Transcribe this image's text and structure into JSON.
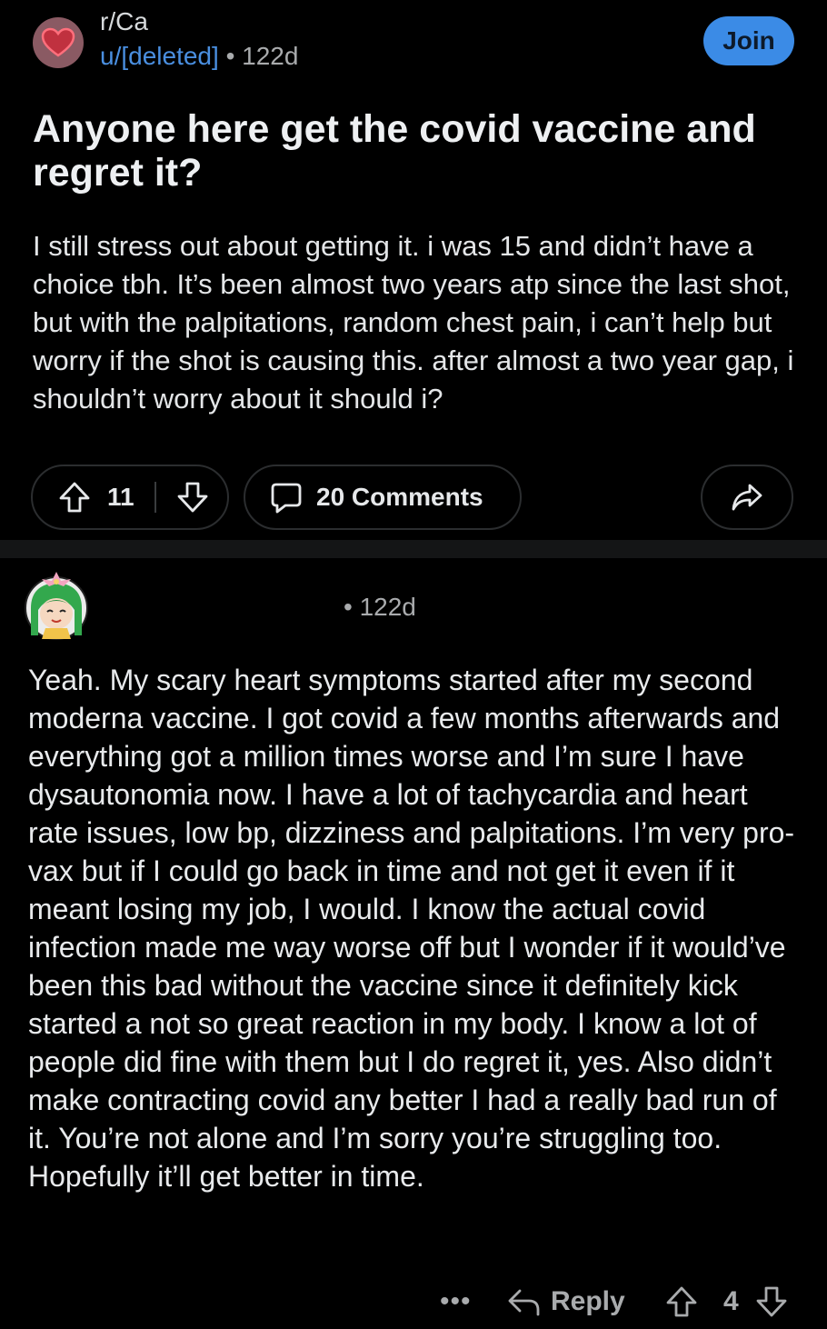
{
  "post": {
    "subreddit": "r/Ca",
    "author": "u/[deleted]",
    "separator": "•",
    "age": "122d",
    "join_label": "Join",
    "title": "Anyone here get the covid vaccine and regret it?",
    "body": "I still stress out about getting it. i was 15 and didn’t have a choice tbh. It’s been almost two years atp since the last shot, but with the palpitations, random chest pain, i can’t help but worry if the shot is causing this. after almost a two year gap, i shouldn’t worry about it should i?",
    "score": "11",
    "comments_label": "20 Comments"
  },
  "comment": {
    "separator": "•",
    "age": "122d",
    "body": "Yeah. My scary heart symptoms started after my second moderna vaccine. I got covid a few months afterwards and everything got a million times worse and I’m sure I have dysautonomia now. I have a lot of tachycardia and heart rate issues, low bp, dizziness and palpitations. I’m very pro-vax but if I could go back in time and not get it even if it meant losing my job, I would. I know the actual covid infection made me way worse off but I wonder if it would’ve been this bad without the vaccine since it definitely kick started a not so great reaction in my body. I know a lot of people did fine with them but I do regret it, yes. Also didn’t make contracting covid any better I had a really bad run of it. You’re not alone and I’m sorry you’re struggling too. Hopefully it’ll get better in time.",
    "more_label": "•••",
    "reply_label": "Reply",
    "score": "4"
  },
  "icons": {
    "subreddit": "heart-icon",
    "upvote": "arrow-up-icon",
    "downvote": "arrow-down-icon",
    "comments": "speech-bubble-icon",
    "share": "share-arrow-icon",
    "reply": "reply-arrow-icon"
  },
  "colors": {
    "background": "#000000",
    "link": "#4a8fe0",
    "join_button": "#3b8be6",
    "muted": "#a9abad",
    "pill_border": "#2b2d2f"
  }
}
